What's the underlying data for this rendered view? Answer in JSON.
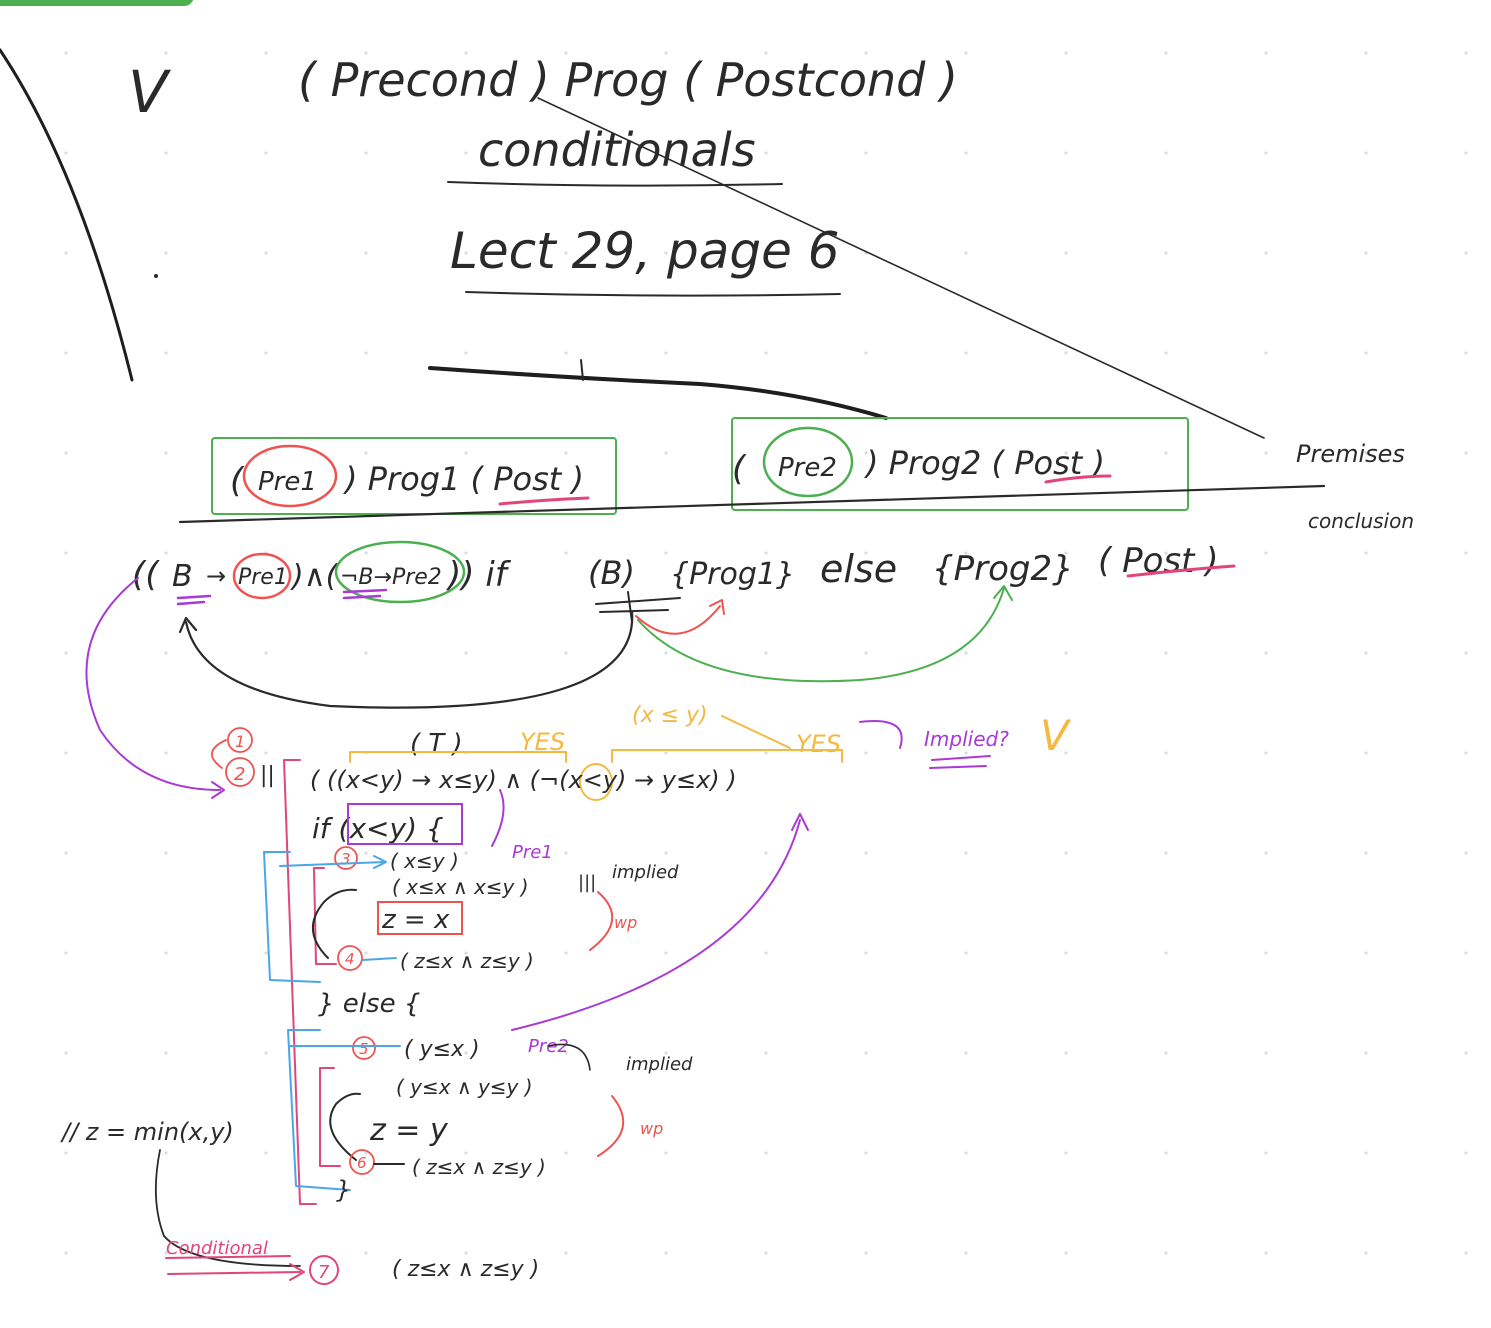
{
  "colors": {
    "accent": "#4caf50",
    "ink_black": "#2a2a2a",
    "ink_green": "#4caf50",
    "ink_red": "#ef5350",
    "ink_purple": "#a93ad6",
    "ink_orange": "#f4b942",
    "ink_blue": "#4aa6e8",
    "ink_pink": "#e0457b",
    "grid_dot": "#d9dde3"
  },
  "header": {
    "mark": "V",
    "triple": "( Precond ) Prog ( Postcond )",
    "topic": "conditionals",
    "reference": "Lect 29, page 6"
  },
  "rule": {
    "premise1_pre": "Pre1",
    "premise1_rest": ") Prog1 ( Post )",
    "premise2_pre": "Pre2",
    "premise2_rest": ") Prog2 ( Post )",
    "premise1_open": "(",
    "premise2_open": "(",
    "premises_label": "Premises",
    "conclusion_label": "conclusion",
    "conclusion": {
      "open": "((",
      "b": "B",
      "arrow1": "→",
      "pre1": "Pre1",
      "and": ")∧(",
      "notb": "¬B→Pre2",
      "close": ")) if",
      "cond": "(B)",
      "prog1": "{Prog1}",
      "else": "else",
      "prog2": "{Prog2}",
      "post": "( Post )"
    }
  },
  "proof": {
    "step1": "1",
    "step2": "2",
    "top_pre": "( T )",
    "yes1": "YES",
    "xley": "(x ≤ y)",
    "yes2": "YES",
    "implied_q": "Implied?",
    "check": "V",
    "line2": "( ((x<y) → x≤y) ∧ (¬(x<y) → y≤x) )",
    "if_line": "if (x<y) {",
    "step3": "3",
    "pre1_assert": "( x≤y )",
    "pre1_tag": "Pre1",
    "wp_assert1": "( x≤x ∧ x≤y )",
    "implied1": "implied",
    "assign1": "z = x",
    "wp_tag1": "wp",
    "step4": "4",
    "post_assert1": "( z≤x ∧ z≤y )",
    "else_line": "} else {",
    "step5": "5",
    "pre2_assert": "( y≤x )",
    "pre2_tag": "Pre2",
    "implied2": "implied",
    "wp_assert2": "( y≤x ∧ y≤y )",
    "comment": "// z = min(x,y)",
    "assign2": "z = y",
    "wp_tag2": "wp",
    "step6": "6",
    "post_assert2": "( z≤x ∧ z≤y )",
    "close_brace": "}",
    "conditional_label": "Conditional",
    "step7": "7",
    "final_post": "( z≤x ∧ z≤y )"
  }
}
